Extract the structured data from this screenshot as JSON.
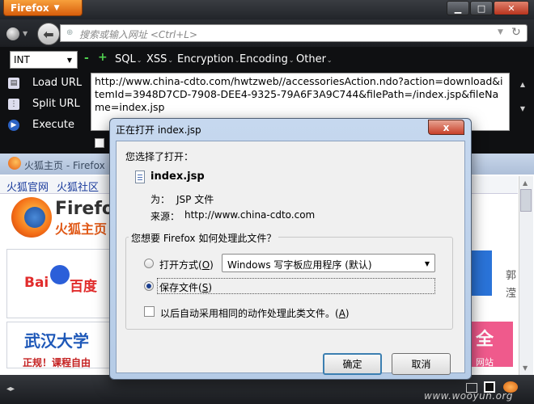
{
  "browser": {
    "menu_button": "Firefox",
    "url_placeholder": "搜索或输入网址 <Ctrl+L>"
  },
  "hackbar": {
    "type_select": "INT",
    "minus": "-",
    "plus": "+",
    "menus": [
      "SQL",
      "XSS",
      "Encryption",
      "Encoding",
      "Other"
    ],
    "actions": [
      "Load URL",
      "Split URL",
      "Execute"
    ],
    "url_text": "http://www.china-cdto.com/hwtzweb//accessoriesAction.ndo?action=download&itemId=3948D7CD-7908-DEE4-9325-79A6F3A9C744&filePath=/index.jsp&fileName=index.jsp"
  },
  "background_window": {
    "title": "火狐主页 - Firefox",
    "links": [
      "火狐官网",
      "火狐社区"
    ],
    "brand": "Firefox",
    "brand_sub": "火狐主页",
    "baidu_left": "Bai",
    "baidu_right": "百度",
    "wuhan": "武汉大学",
    "wuhan_sub": "正规！课程自由",
    "pink_text": "全",
    "pink_sub": "网站",
    "side_1": "郭",
    "side_2": "滢"
  },
  "dialog": {
    "title": "正在打开 index.jsp",
    "close": "x",
    "chosen_label": "您选择了打开：",
    "file_name": "index.jsp",
    "type_label": "为：",
    "type_value": "JSP 文件",
    "from_label": "来源：",
    "from_value": "http://www.china-cdto.com",
    "group_label": "您想要 Firefox 如何处理此文件？",
    "open_with": {
      "text": "打开方式(",
      "key": "O",
      "end": ")"
    },
    "app_value": "Windows 写字板应用程序 (默认)",
    "save_file": {
      "text": "保存文件(",
      "key": "S",
      "end": ")"
    },
    "auto_action": {
      "text": "以后自动采用相同的动作处理此类文件。(",
      "key": "A",
      "end": ")"
    },
    "selected_option": "save_file",
    "ok": "确定",
    "cancel": "取消"
  },
  "statusbar": {
    "watermark": "www.wooyun.org"
  }
}
